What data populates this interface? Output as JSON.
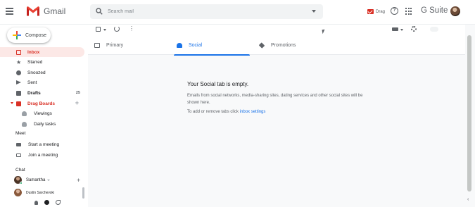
{
  "header": {
    "app_name": "Gmail",
    "search_placeholder": "Search mail",
    "drag_label": "Drag",
    "suite_label": "G Suite"
  },
  "sidebar": {
    "compose_label": "Compose",
    "items": [
      {
        "label": "Inbox",
        "count": "",
        "icon": "inbox-icon"
      },
      {
        "label": "Starred",
        "count": "",
        "icon": "star-icon"
      },
      {
        "label": "Snoozed",
        "count": "",
        "icon": "clock-icon"
      },
      {
        "label": "Sent",
        "count": "",
        "icon": "send-icon"
      },
      {
        "label": "Drafts",
        "count": "25",
        "icon": "draft-icon"
      },
      {
        "label": "Drag Boards",
        "count": "",
        "icon": "drag-board-icon"
      },
      {
        "label": "Viewings",
        "count": "",
        "icon": "people-icon"
      },
      {
        "label": "Daily tasks",
        "count": "",
        "icon": "person-icon"
      }
    ],
    "meet": {
      "title": "Meet",
      "start_label": "Start a meeting",
      "join_label": "Join a meeting"
    },
    "chat": {
      "title": "Chat",
      "users": [
        {
          "name": "Samantha"
        },
        {
          "name": "Dustin Sarchevski"
        }
      ]
    }
  },
  "main": {
    "tabs": [
      {
        "label": "Primary",
        "icon": "inbox-icon"
      },
      {
        "label": "Social",
        "icon": "people-icon"
      },
      {
        "label": "Promotions",
        "icon": "tag-icon"
      }
    ],
    "active_tab": "Social",
    "empty_state": {
      "title": "Your Social tab is empty.",
      "description": "Emails from social networks, media-sharing sites, dating services and other social sites will be shown here.",
      "settings_prefix": "To add or remove tabs click",
      "settings_link": "inbox settings"
    }
  },
  "colors": {
    "accent": "#1a73e8",
    "brand_red": "#d93025",
    "active_bg": "#fce8e6"
  }
}
